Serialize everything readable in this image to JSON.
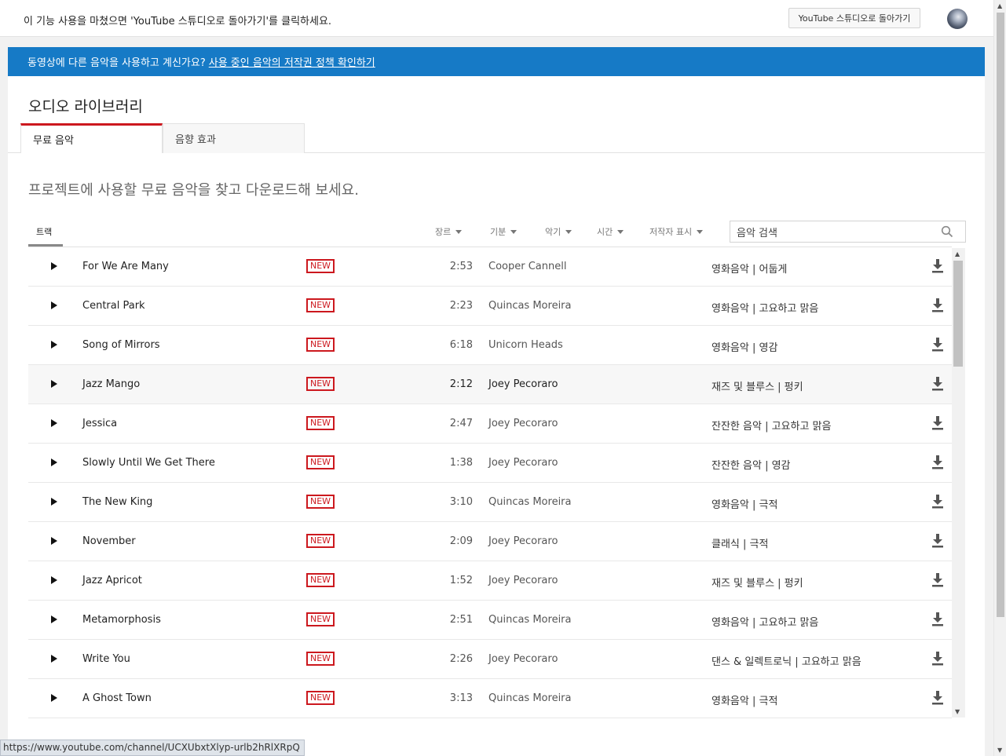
{
  "topbar": {
    "message": "이 기능 사용을 마쳤으면 'YouTube 스튜디오로 돌아가기'를 클릭하세요.",
    "back_button": "YouTube 스튜디오로 돌아가기"
  },
  "banner": {
    "lead": "동영상에 다른 음악을 사용하고 계신가요?",
    "link": "사용 중인 음악의 저작권 정책 확인하기",
    "color": "#167ac6"
  },
  "page": {
    "title": "오디오 라이브러리",
    "tabs": [
      "무료 음악",
      "음향 효과"
    ],
    "subtitle": "프로젝트에 사용할 무료 음악을 찾고 다운로드해 보세요."
  },
  "filters": {
    "tracks_label": "트랙",
    "genre": "장르",
    "mood": "기분",
    "instrument": "악기",
    "duration": "시간",
    "attribution": "저작자 표시",
    "search_placeholder": "음악 검색"
  },
  "badge_label": "NEW",
  "accent_color": "#cc181e",
  "tracks": [
    {
      "title": "For We Are Many",
      "duration": "2:53",
      "artist": "Cooper Cannell",
      "genre": "영화음악 | 어둡게"
    },
    {
      "title": "Central Park",
      "duration": "2:23",
      "artist": "Quincas Moreira",
      "genre": "영화음악 | 고요하고 맑음"
    },
    {
      "title": "Song of Mirrors",
      "duration": "6:18",
      "artist": "Unicorn Heads",
      "genre": "영화음악 | 영감"
    },
    {
      "title": "Jazz Mango",
      "duration": "2:12",
      "artist": "Joey Pecoraro",
      "genre": "재즈 및 블루스 | 펑키"
    },
    {
      "title": "Jessica",
      "duration": "2:47",
      "artist": "Joey Pecoraro",
      "genre": "잔잔한 음악 | 고요하고 맑음"
    },
    {
      "title": "Slowly Until We Get There",
      "duration": "1:38",
      "artist": "Joey Pecoraro",
      "genre": "잔잔한 음악 | 영감"
    },
    {
      "title": "The New King",
      "duration": "3:10",
      "artist": "Quincas Moreira",
      "genre": "영화음악 | 극적"
    },
    {
      "title": "November",
      "duration": "2:09",
      "artist": "Joey Pecoraro",
      "genre": "클래식 | 극적"
    },
    {
      "title": "Jazz Apricot",
      "duration": "1:52",
      "artist": "Joey Pecoraro",
      "genre": "재즈 및 블루스 | 펑키"
    },
    {
      "title": "Metamorphosis",
      "duration": "2:51",
      "artist": "Quincas Moreira",
      "genre": "영화음악 | 고요하고 맑음"
    },
    {
      "title": "Write You",
      "duration": "2:26",
      "artist": "Joey Pecoraro",
      "genre": "댄스 & 일렉트로닉 | 고요하고 맑음"
    },
    {
      "title": "A Ghost Town",
      "duration": "3:13",
      "artist": "Quincas Moreira",
      "genre": "영화음악 | 극적"
    }
  ],
  "statusbar": {
    "url": "https://www.youtube.com/channel/UCXUbxtXlyp-urlb2hRlXRpQ"
  }
}
